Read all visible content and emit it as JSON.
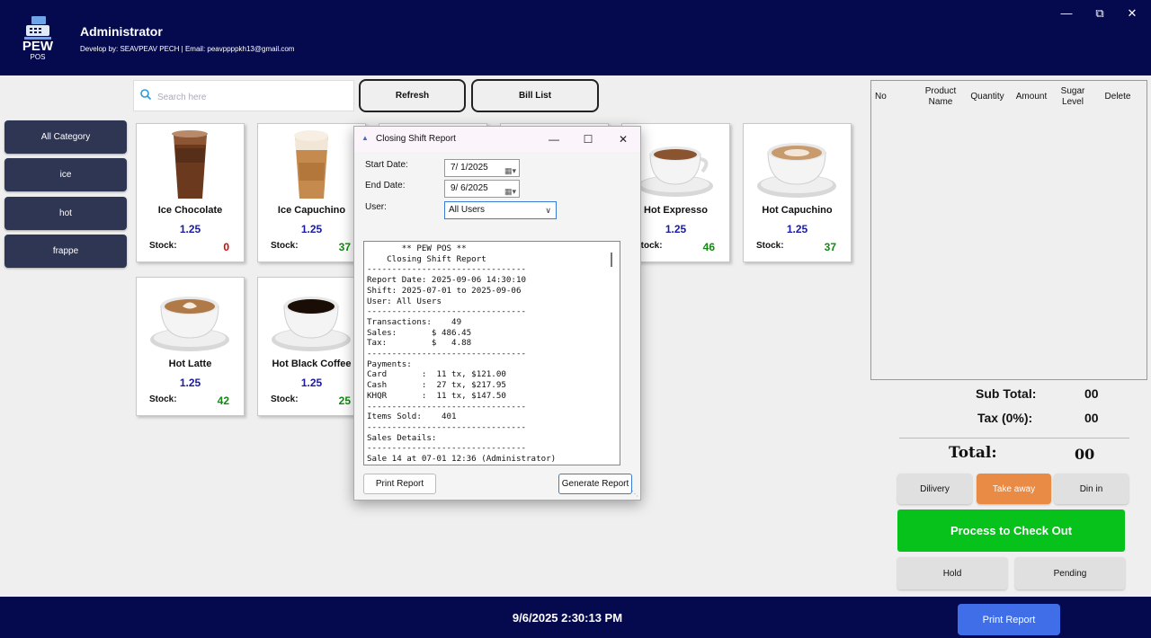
{
  "header": {
    "logo_word": "PEW",
    "logo_sub": "POS",
    "title": "Administrator",
    "subtitle": "Develop by: SEAVPEAV PECH | Email: peavppppkh13@gmail.com",
    "window_controls": [
      "minimize-icon",
      "maximize-icon",
      "close-icon"
    ]
  },
  "search": {
    "placeholder": "Search here",
    "value": ""
  },
  "top_buttons": {
    "refresh": "Refresh",
    "bill_list": "Bill List"
  },
  "categories": [
    "All Category",
    "ice",
    "hot",
    "frappe"
  ],
  "products": [
    {
      "name": "Ice Chocolate",
      "price": "1.25",
      "stock_label": "Stock:",
      "stock": "0",
      "stock_color": "#e00000",
      "icon": "iced-chocolate-image"
    },
    {
      "name": "Ice Capuchino",
      "price": "1.25",
      "stock_label": "Stock:",
      "stock": "37",
      "stock_color": "#108a10",
      "icon": "iced-cappuccino-image"
    },
    {
      "name": "Hot Expresso",
      "price": "1.25",
      "stock_label": "Stock:",
      "stock": "46",
      "stock_color": "#108a10",
      "icon": "espresso-cup-image"
    },
    {
      "name": "Hot Capuchino",
      "price": "1.25",
      "stock_label": "Stock:",
      "stock": "37",
      "stock_color": "#108a10",
      "icon": "cappuccino-cup-image"
    },
    {
      "name": "Hot Latte",
      "price": "1.25",
      "stock_label": "Stock:",
      "stock": "42",
      "stock_color": "#108a10",
      "icon": "latte-cup-image"
    },
    {
      "name": "Hot Black Coffee",
      "price": "1.25",
      "stock_label": "Stock:",
      "stock": "25",
      "stock_color": "#108a10",
      "icon": "black-coffee-cup-image"
    }
  ],
  "order_table": {
    "columns": [
      "No",
      "Product Name",
      "Quantity",
      "Amount",
      "Sugar Level",
      "Delete"
    ],
    "rows": []
  },
  "summary": {
    "subtotal_label": "Sub Total:",
    "subtotal": "00",
    "tax_label": "Tax (0%):",
    "tax": "00",
    "total_label": "Total:",
    "total": "00"
  },
  "order_types": [
    "Dilivery",
    "Take away",
    "Din in"
  ],
  "order_type_selected": "Take away",
  "checkout_label": "Process to Check Out",
  "hold_label": "Hold",
  "pending_label": "Pending",
  "footer": {
    "datetime": "9/6/2025 2:30:13 PM",
    "print_report": "Print Report"
  },
  "dialog": {
    "title": "Closing Shift Report",
    "start_date_label": "Start Date:",
    "start_date": "7/ 1/2025",
    "end_date_label": "End Date:",
    "end_date": "9/ 6/2025",
    "user_label": "User:",
    "user_selected": "All Users",
    "report_lines": [
      "       ** PEW POS **",
      "    Closing Shift Report",
      "--------------------------------",
      "Report Date: 2025-09-06 14:30:10",
      "Shift: 2025-07-01 to 2025-09-06",
      "User: All Users",
      "--------------------------------",
      "Transactions:    49",
      "Sales:       $ 486.45",
      "Tax:         $   4.88",
      "--------------------------------",
      "Payments:",
      "Card       :  11 tx, $121.00",
      "Cash       :  27 tx, $217.95",
      "KHQR       :  11 tx, $147.50",
      "--------------------------------",
      "Items Sold:    401",
      "--------------------------------",
      "Sales Details:",
      "--------------------------------",
      "Sale 14 at 07-01 12:36 (Administrator)"
    ],
    "print_button": "Print Report",
    "generate_button": "Generate Report"
  },
  "colors": {
    "header_bg": "#050a4e",
    "category_bg": "#2f3654",
    "price": "#1a1aa6",
    "checkout": "#08c21c",
    "take_away_selected": "#e98a45",
    "print_report_button": "#3f6ee8"
  }
}
